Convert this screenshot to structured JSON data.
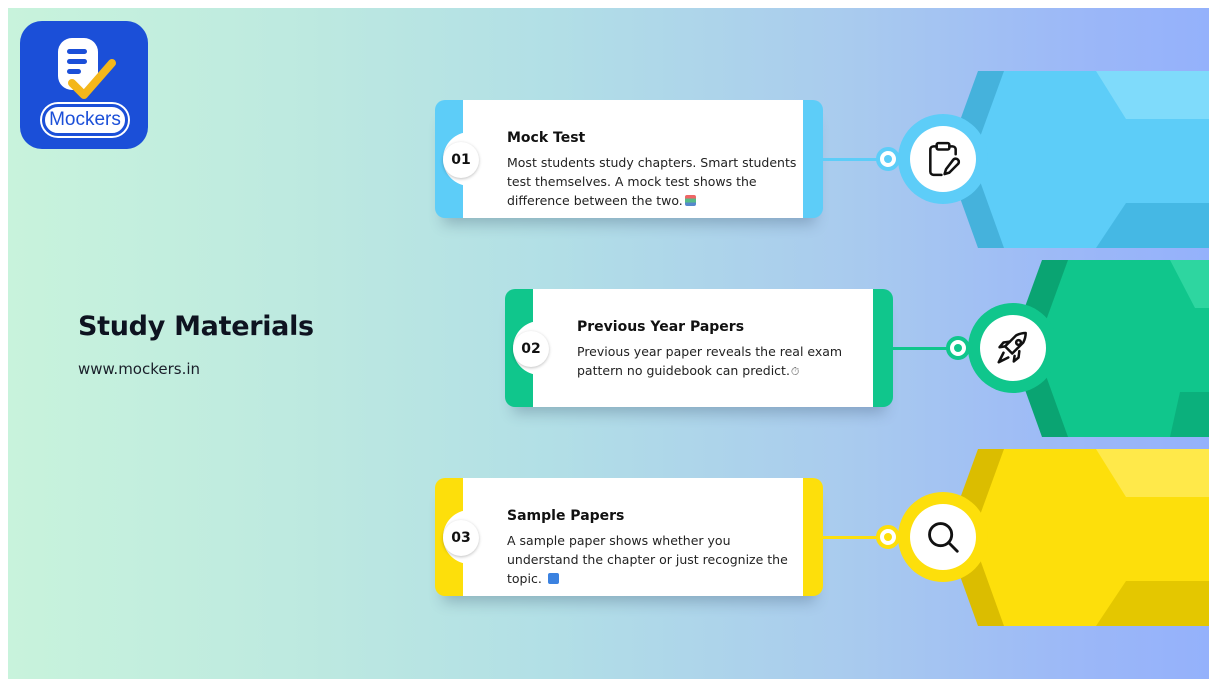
{
  "brand": {
    "logo_text": "Mockers",
    "color": "#1b4fd8"
  },
  "page": {
    "title": "Study Materials",
    "website": "www.mockers.in"
  },
  "steps": [
    {
      "number": "01",
      "title": "Mock Test",
      "description": "Most students study chapters. Smart students test themselves. A mock test shows the difference between the two.",
      "emoji": "books",
      "icon": "clipboard-edit-icon",
      "accent": "#5dcdf8",
      "accent_dark": "#45b2dc"
    },
    {
      "number": "02",
      "title": "Previous Year Papers",
      "description": "Previous year paper reveals the real exam pattern no guidebook can predict.",
      "emoji": "stopwatch",
      "icon": "rocket-icon",
      "accent": "#10c68c",
      "accent_dark": "#0aa472"
    },
    {
      "number": "03",
      "title": "Sample Papers",
      "description": "A sample paper shows whether you understand the chapter or just recognize the topic.",
      "emoji": "blue-book",
      "icon": "search-icon",
      "accent": "#fddf0b",
      "accent_dark": "#dbbd00"
    }
  ]
}
